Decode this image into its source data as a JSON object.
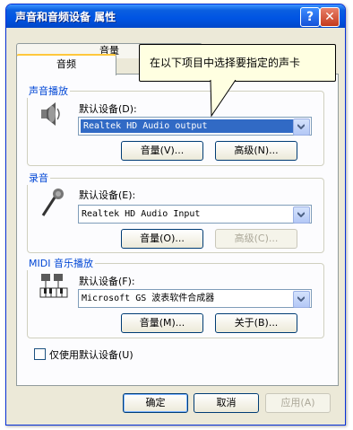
{
  "window": {
    "title": "声音和音频设备 属性",
    "help_label": "?",
    "close_label": "✕"
  },
  "tabs": {
    "back_label": "音量",
    "active_label": "音频"
  },
  "tooltip": {
    "text": "在以下项目中选择要指定的声卡"
  },
  "playback": {
    "group_title": "声音播放",
    "device_label": "默认设备(D):",
    "device_value": "Realtek HD Audio output",
    "volume_button": "音量(V)...",
    "advanced_button": "高级(N)...",
    "icon": "speaker-icon"
  },
  "recording": {
    "group_title": "录音",
    "device_label": "默认设备(E):",
    "device_value": "Realtek HD Audio Input",
    "volume_button": "音量(O)...",
    "advanced_button": "高级(C)...",
    "icon": "microphone-icon"
  },
  "midi": {
    "group_title": "MIDI 音乐播放",
    "device_label": "默认设备(F):",
    "device_value": "Microsoft GS 波表软件合成器",
    "volume_button": "音量(M)...",
    "about_button": "关于(B)...",
    "icon": "midi-keyboard-icon"
  },
  "options": {
    "default_only_label": "仅使用默认设备(U)",
    "default_only_checked": false
  },
  "footer": {
    "ok_label": "确定",
    "cancel_label": "取消",
    "apply_label": "应用(A)"
  },
  "colors": {
    "titlebar": "#0054e3",
    "group_title": "#0046d5",
    "selection": "#316ac5",
    "tooltip_bg": "#ffffe1"
  }
}
